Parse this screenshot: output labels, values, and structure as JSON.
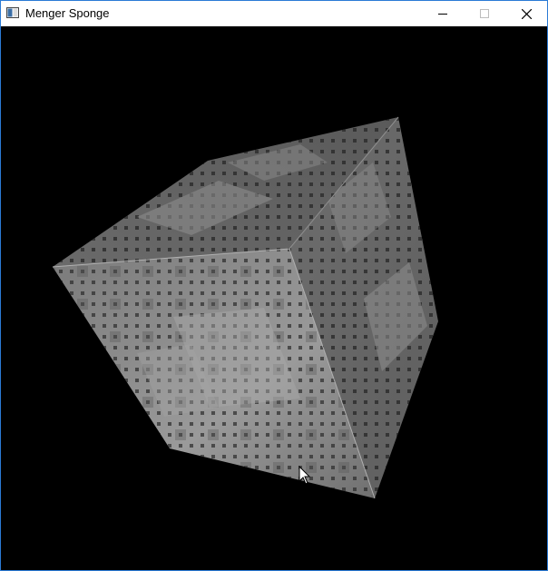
{
  "window": {
    "title": "Menger Sponge",
    "controls": {
      "minimize": "minimize-icon",
      "maximize": "maximize-icon",
      "close": "close-icon"
    },
    "accent_color": "#2b7bd6"
  },
  "viewport": {
    "background": "#000000",
    "object": "menger-sponge",
    "cube_color": "#8a8a8a"
  }
}
